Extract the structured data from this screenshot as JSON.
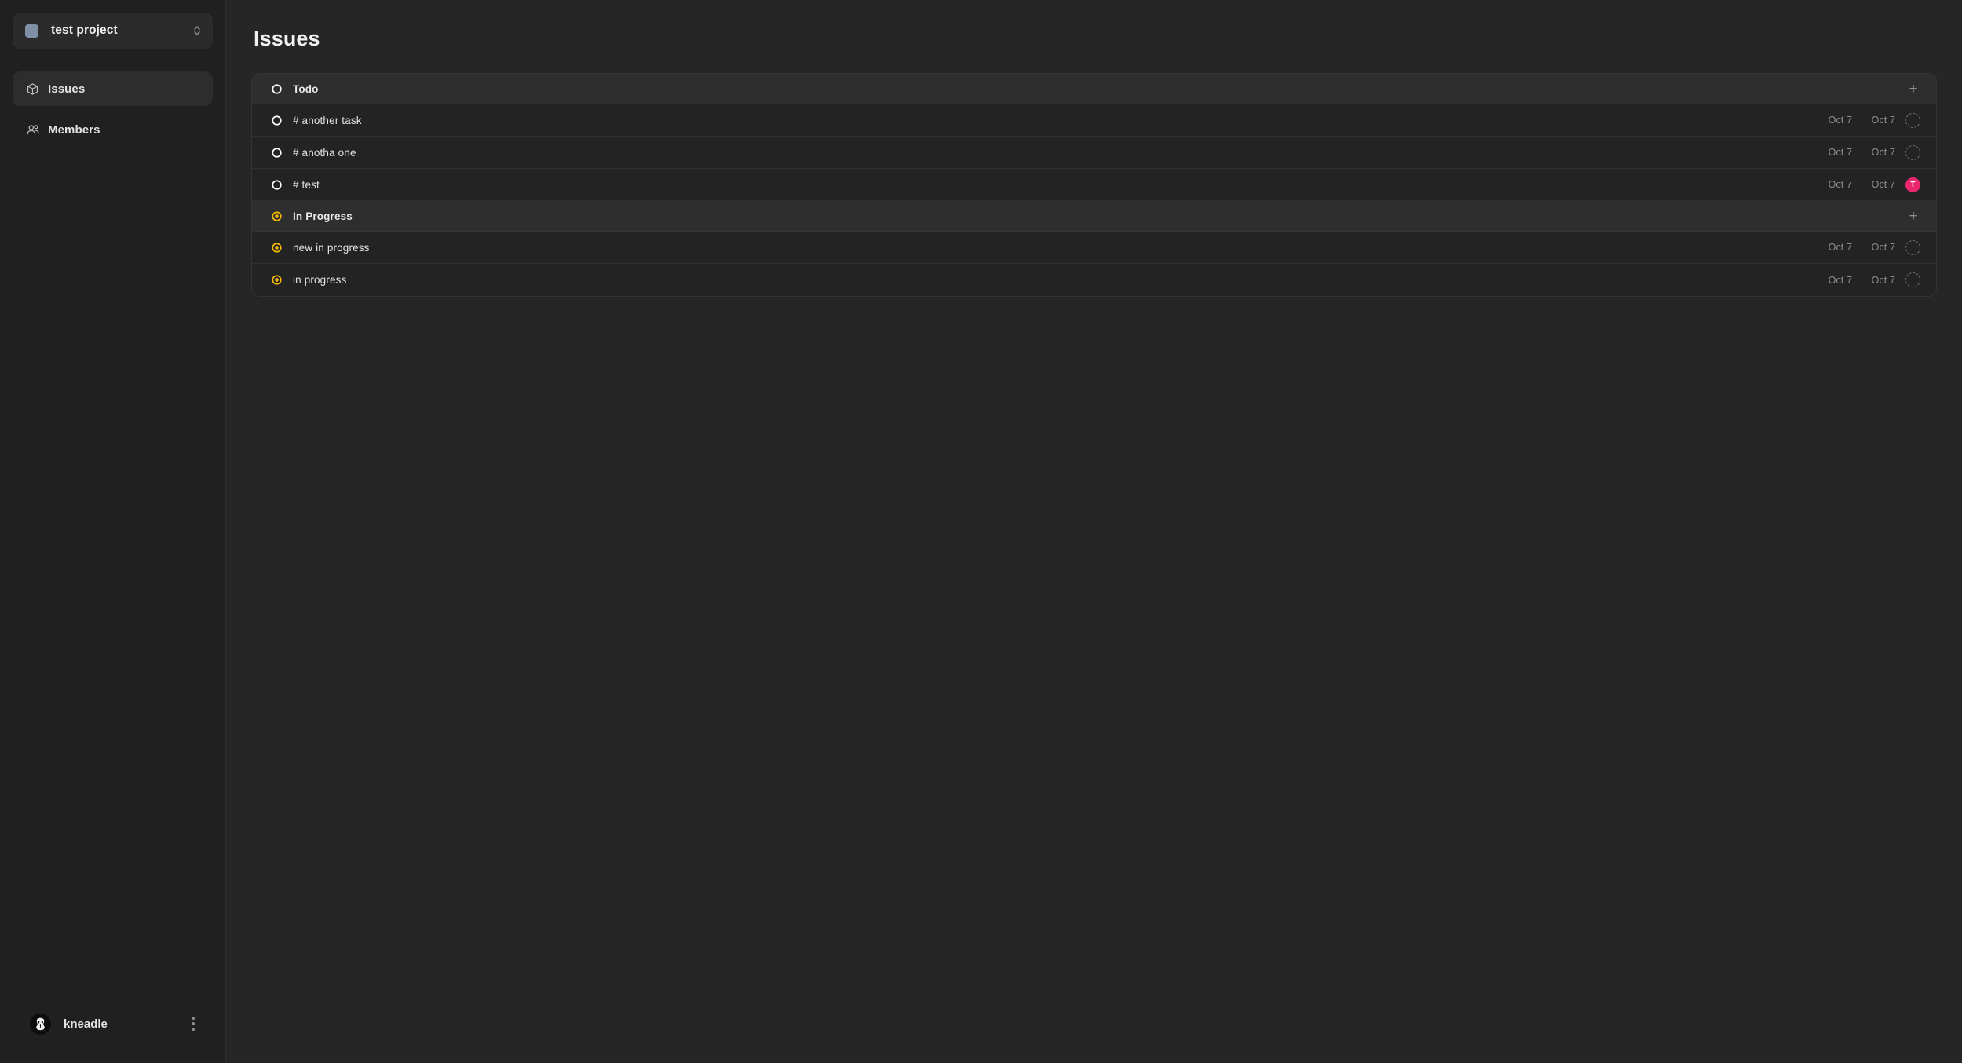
{
  "sidebar": {
    "project_switcher": {
      "name": "test project",
      "swatch_color": "#7e8fa6",
      "icon": "chevron-up-down-icon"
    },
    "nav_items": [
      {
        "label": "Issues",
        "icon": "cube-icon",
        "active": true
      },
      {
        "label": "Members",
        "icon": "people-icon",
        "active": false
      }
    ],
    "user": {
      "name": "kneadle",
      "avatar_icon": "user-avatar",
      "menu_icon": "kebab-menu-icon"
    }
  },
  "main": {
    "page_title": "Issues",
    "add_icon": "plus-icon",
    "groups": [
      {
        "label": "Todo",
        "status": "todo",
        "status_color": "#ffffff",
        "add_label": "+",
        "issues": [
          {
            "title": "# another task",
            "status": "todo",
            "start_date": "Oct 7",
            "end_date": "Oct 7",
            "assignee": null,
            "assignee_initial": ""
          },
          {
            "title": "# anotha one",
            "status": "todo",
            "start_date": "Oct 7",
            "end_date": "Oct 7",
            "assignee": null,
            "assignee_initial": ""
          },
          {
            "title": "# test",
            "status": "todo",
            "start_date": "Oct 7",
            "end_date": "Oct 7",
            "assignee": "T",
            "assignee_initial": "T",
            "assignee_color": "#e8276f"
          }
        ]
      },
      {
        "label": "In Progress",
        "status": "in-progress",
        "status_color": "#f2b705",
        "add_label": "+",
        "issues": [
          {
            "title": "new in progress",
            "status": "in-progress",
            "start_date": "Oct 7",
            "end_date": "Oct 7",
            "assignee": null,
            "assignee_initial": ""
          },
          {
            "title": "in progress",
            "status": "in-progress",
            "start_date": "Oct 7",
            "end_date": "Oct 7",
            "assignee": null,
            "assignee_initial": ""
          }
        ]
      }
    ]
  },
  "colors": {
    "background": "#262626",
    "sidebar": "#202020",
    "panel": "#232323",
    "group_header": "#2e2e2e",
    "accent_pink": "#e8276f",
    "accent_yellow": "#f2b705"
  }
}
